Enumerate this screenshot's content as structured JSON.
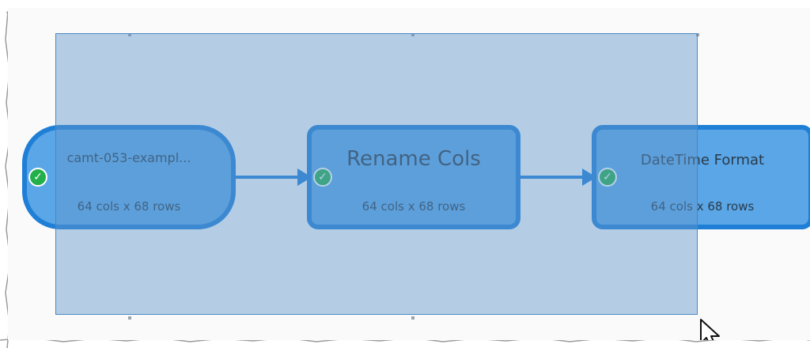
{
  "pipeline": {
    "nodes": [
      {
        "title": "camt-053-exampl...",
        "subtitle": "64 cols x 68 rows",
        "status": "success"
      },
      {
        "title": "Rename Cols",
        "subtitle": "64 cols x 68 rows",
        "status": "success"
      },
      {
        "title": "DateTime Format",
        "subtitle": "64 cols x 68 rows",
        "status": "success"
      }
    ],
    "check_glyph": "✓"
  },
  "colors": {
    "node_fill": "#5aa6e6",
    "node_border": "#1f7fd6",
    "selection_fill": "rgba(95,150,205,0.45)",
    "success_badge": "#23b04b"
  }
}
